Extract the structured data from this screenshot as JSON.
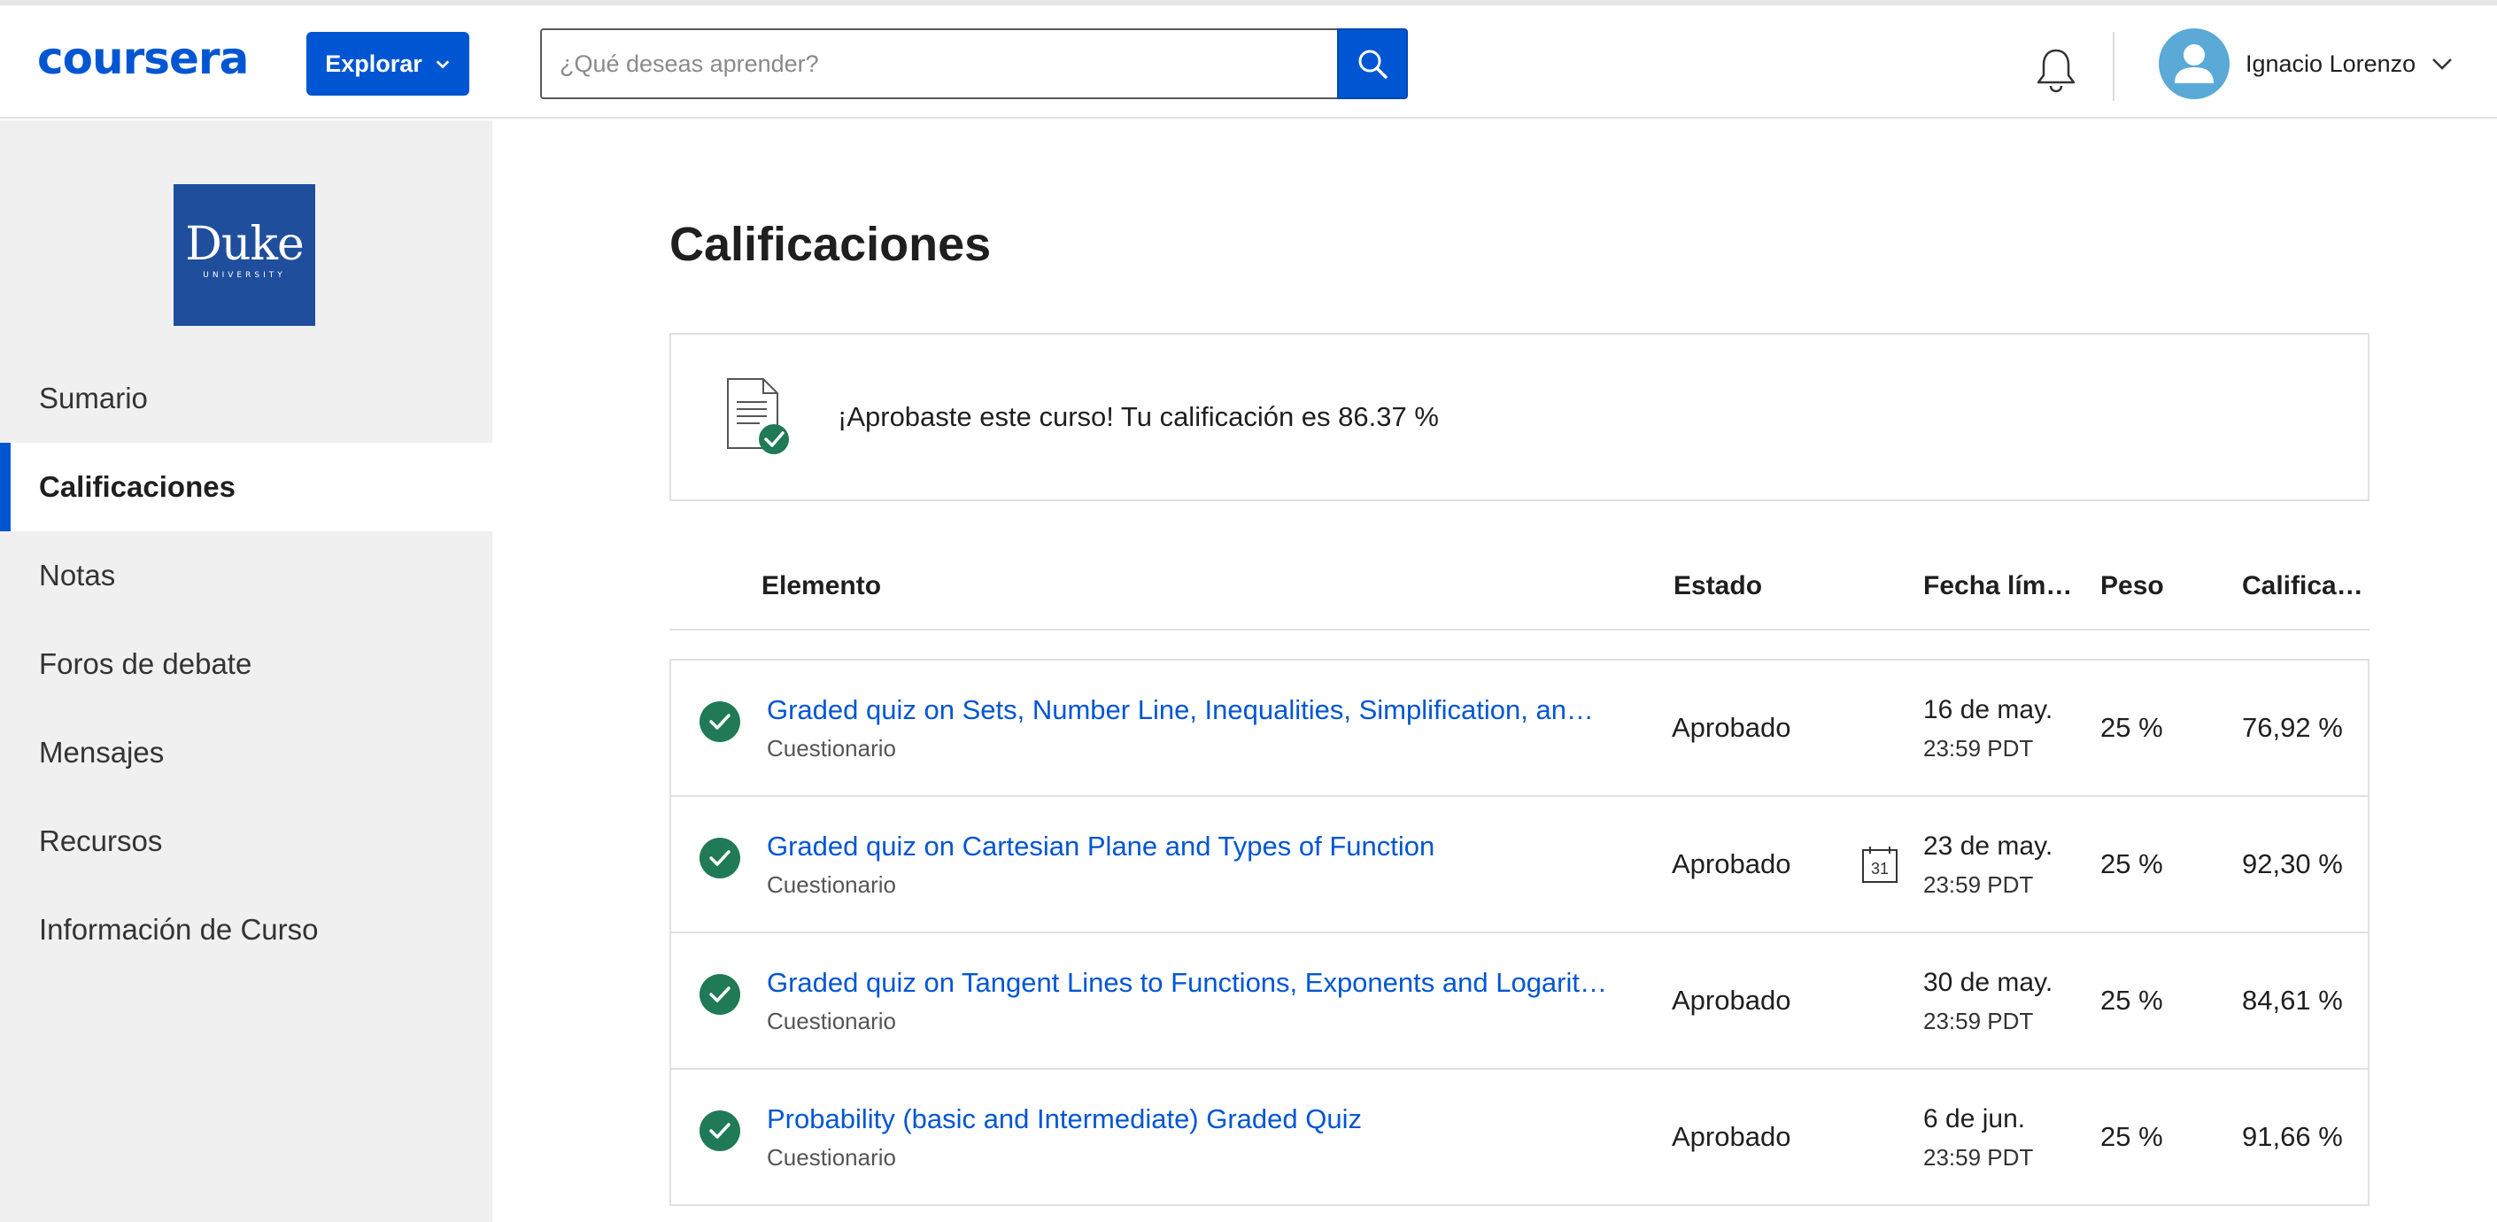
{
  "header": {
    "logo": "coursera",
    "explore_label": "Explorar",
    "search_placeholder": "¿Qué deseas aprender?",
    "user_name": "Ignacio Lorenzo"
  },
  "sidebar": {
    "university_logo": {
      "name": "Duke",
      "subtitle": "UNIVERSITY",
      "color": "#1f4e9c"
    },
    "items": [
      {
        "label": "Sumario"
      },
      {
        "label": "Calificaciones",
        "active": true
      },
      {
        "label": "Notas"
      },
      {
        "label": "Foros de debate"
      },
      {
        "label": "Mensajes"
      },
      {
        "label": "Recursos"
      },
      {
        "label": "Información de Curso"
      }
    ]
  },
  "main": {
    "title": "Calificaciones",
    "banner_text": "¡Aprobaste este curso! Tu calificación es 86.37 %",
    "columns": {
      "item": "Elemento",
      "status": "Estado",
      "due": "Fecha lím…",
      "weight": "Peso",
      "grade": "Califica…"
    },
    "rows": [
      {
        "title": "Graded quiz on Sets, Number Line, Inequalities, Simplification, an…",
        "type": "Cuestionario",
        "status": "Aprobado",
        "due_date": "16 de may.",
        "due_time": "23:59 PDT",
        "weight": "25 %",
        "grade": "76,92 %",
        "calendar": false
      },
      {
        "title": "Graded quiz on Cartesian Plane and Types of Function",
        "type": "Cuestionario",
        "status": "Aprobado",
        "due_date": "23 de may.",
        "due_time": "23:59 PDT",
        "weight": "25 %",
        "grade": "92,30 %",
        "calendar": true,
        "calendar_day": "31"
      },
      {
        "title": "Graded quiz on Tangent Lines to Functions, Exponents and Logarit…",
        "type": "Cuestionario",
        "status": "Aprobado",
        "due_date": "30 de may.",
        "due_time": "23:59 PDT",
        "weight": "25 %",
        "grade": "84,61 %",
        "calendar": false
      },
      {
        "title": "Probability (basic and Intermediate) Graded Quiz",
        "type": "Cuestionario",
        "status": "Aprobado",
        "due_date": "6 de jun.",
        "due_time": "23:59 PDT",
        "weight": "25 %",
        "grade": "91,66 %",
        "calendar": false
      }
    ]
  },
  "colors": {
    "brand": "#0056d2",
    "success": "#1f7a55",
    "sidebar_bg": "#f0f0f0"
  },
  "icons": [
    "search-icon",
    "bell-icon",
    "avatar-icon",
    "chevron-down-icon",
    "document-check-icon",
    "check-circle-icon",
    "calendar-icon"
  ]
}
